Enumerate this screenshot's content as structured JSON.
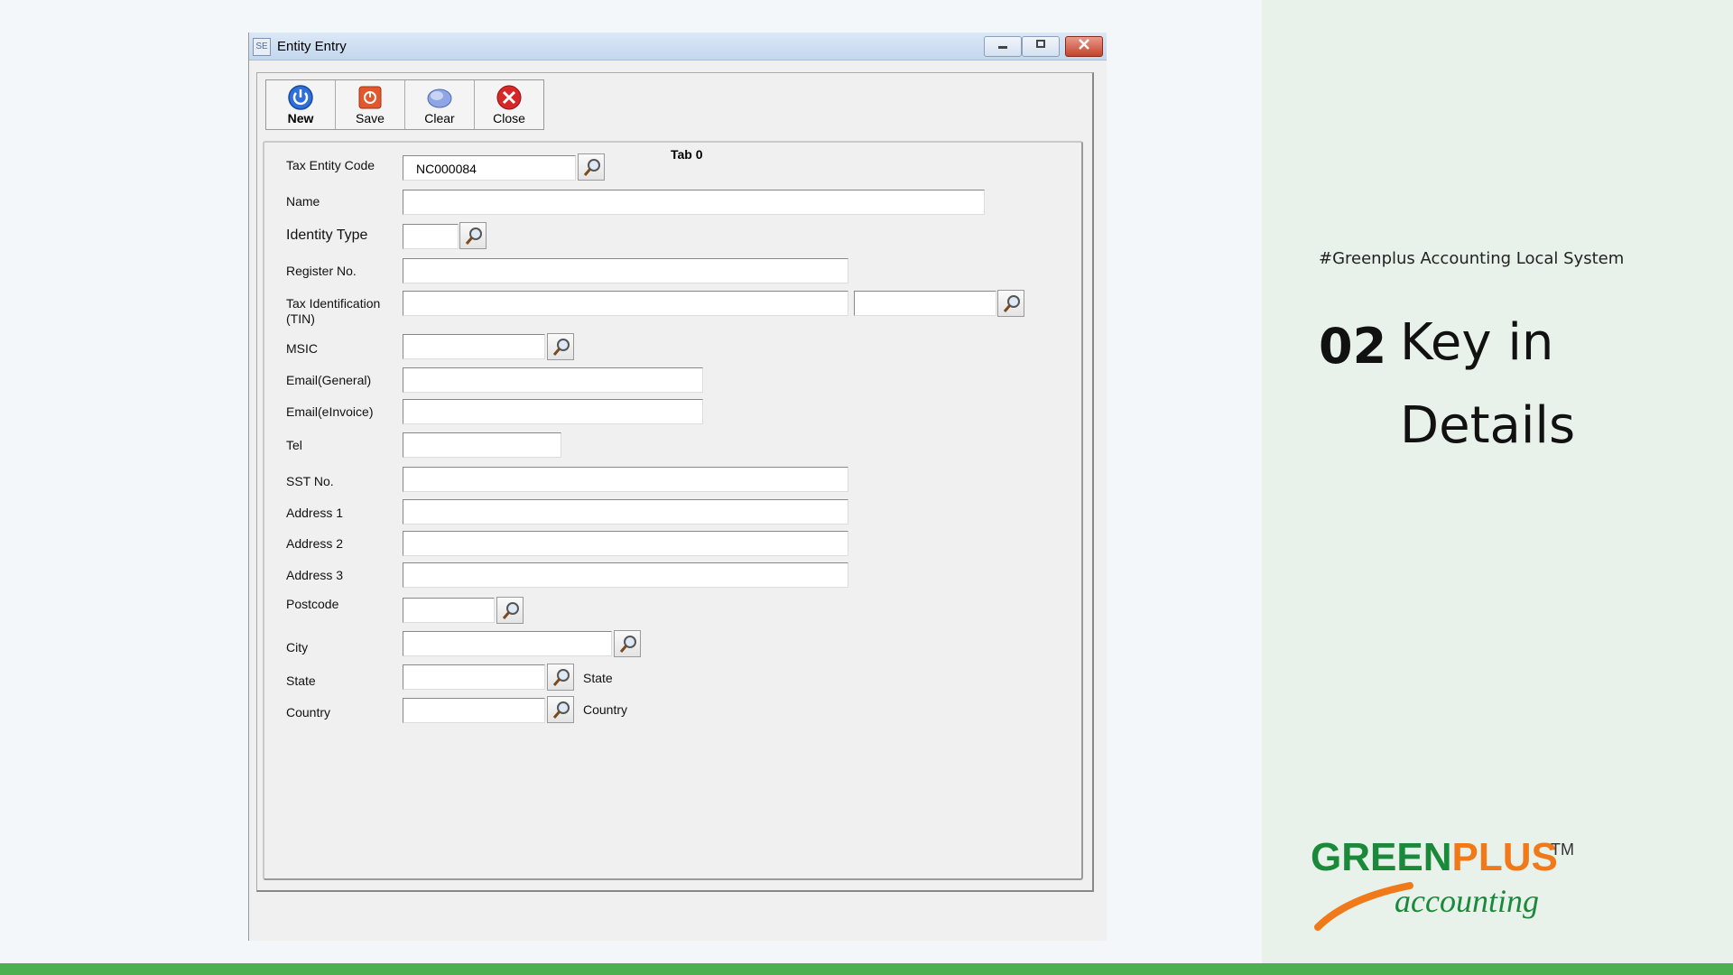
{
  "window": {
    "title": "Entity Entry",
    "icon_text": "SE",
    "minimize_icon": "minimize-icon",
    "maximize_icon": "maximize-icon",
    "close_icon": "close-icon"
  },
  "toolbar": {
    "new_label": "New",
    "save_label": "Save",
    "clear_label": "Clear",
    "close_label": "Close"
  },
  "tab": {
    "title": "Tab 0"
  },
  "form": {
    "tax_entity_code": {
      "label": "Tax Entity Code",
      "value": "NC000084"
    },
    "name": {
      "label": "Name",
      "value": ""
    },
    "identity_type": {
      "label": "Identity Type",
      "value": ""
    },
    "register_no": {
      "label": "Register No.",
      "value": ""
    },
    "tin": {
      "label_line1": "Tax Identification",
      "label_line2": "(TIN)",
      "value": "",
      "value2": ""
    },
    "msic": {
      "label": "MSIC",
      "value": ""
    },
    "email_general": {
      "label": "Email(General)",
      "value": ""
    },
    "email_einvoice": {
      "label": "Email(eInvoice)",
      "value": ""
    },
    "tel": {
      "label": "Tel",
      "value": ""
    },
    "sst_no": {
      "label": "SST No.",
      "value": ""
    },
    "address1": {
      "label": "Address 1",
      "value": ""
    },
    "address2": {
      "label": "Address 2",
      "value": ""
    },
    "address3": {
      "label": "Address 3",
      "value": ""
    },
    "postcode": {
      "label": "Postcode",
      "value": ""
    },
    "city": {
      "label": "City",
      "value": ""
    },
    "state": {
      "label": "State",
      "value": "",
      "desc": "State"
    },
    "country": {
      "label": "Country",
      "value": "",
      "desc": "Country"
    }
  },
  "slide": {
    "hashtag": "#Greenplus Accounting Local System",
    "step_number": "02",
    "step_title": "Key in Details"
  },
  "logo": {
    "green_part": "GREEN",
    "orange_part": "PLUS",
    "tm": "TM",
    "subtitle": "accounting"
  },
  "colors": {
    "accent_green": "#4caf50",
    "brand_green": "#1a8a3a",
    "brand_orange": "#f07a1a",
    "panel_bg": "#e8f1ea"
  }
}
